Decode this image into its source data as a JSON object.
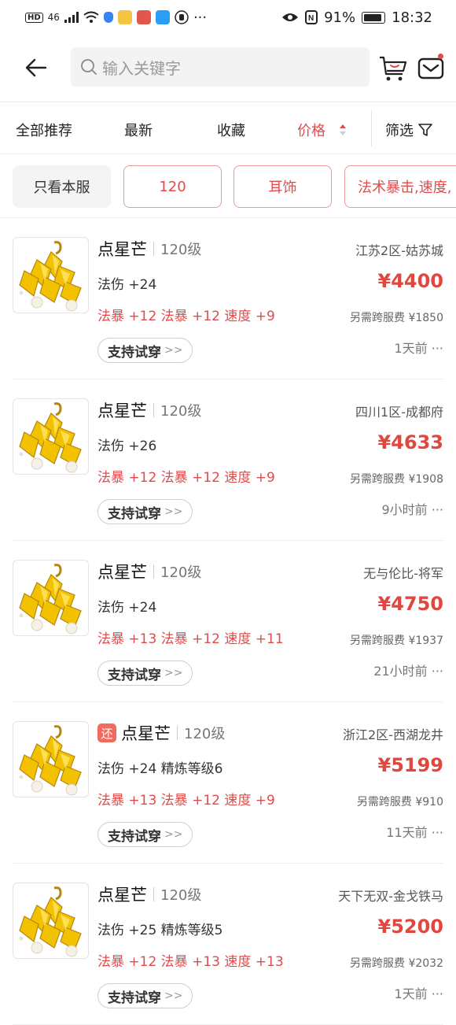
{
  "status_bar": {
    "left_badge": "HD",
    "signal": "46",
    "more": "···",
    "battery": "91%",
    "time": "18:32"
  },
  "header": {
    "search_placeholder": "输入关键字"
  },
  "tabs": {
    "items": [
      "全部推荐",
      "最新",
      "收藏",
      "价格"
    ],
    "active": "价格",
    "filter_label": "筛选"
  },
  "chips": [
    "只看本服",
    "120",
    "耳饰",
    "法术暴击,速度,"
  ],
  "listings": [
    {
      "name": "点星芒",
      "has_badge": false,
      "level": "120级",
      "attr1": "法伤 +24",
      "attr2": "法暴 +12 法暴 +12 速度 +9",
      "server": "江苏2区-姑苏城",
      "price": "¥4400",
      "fee": "另需跨服费 ¥1850",
      "time": "1天前 ···",
      "tryon": "支持试穿"
    },
    {
      "name": "点星芒",
      "has_badge": false,
      "level": "120级",
      "attr1": "法伤 +26",
      "attr2": "法暴 +12 法暴 +12 速度 +9",
      "server": "四川1区-成都府",
      "price": "¥4633",
      "fee": "另需跨服费 ¥1908",
      "time": "9小时前 ···",
      "tryon": "支持试穿"
    },
    {
      "name": "点星芒",
      "has_badge": false,
      "level": "120级",
      "attr1": "法伤 +24",
      "attr2": "法暴 +13 法暴 +12 速度 +11",
      "server": "无与伦比-将军",
      "price": "¥4750",
      "fee": "另需跨服费 ¥1937",
      "time": "21小时前 ···",
      "tryon": "支持试穿"
    },
    {
      "name": "点星芒",
      "has_badge": true,
      "badge": "还",
      "level": "120级",
      "attr1": "法伤 +24 精炼等级6",
      "attr2": "法暴 +13 法暴 +12 速度 +9",
      "server": "浙江2区-西湖龙井",
      "price": "¥5199",
      "fee": "另需跨服费 ¥910",
      "time": "11天前 ···",
      "tryon": "支持试穿"
    },
    {
      "name": "点星芒",
      "has_badge": false,
      "level": "120级",
      "attr1": "法伤 +25 精炼等级5",
      "attr2": "法暴 +12 法暴 +13 速度 +13",
      "server": "天下无双-金戈铁马",
      "price": "¥5200",
      "fee": "另需跨服费 ¥2032",
      "time": "1天前 ···",
      "tryon": "支持试穿"
    }
  ],
  "colors": {
    "accent": "#e04b4b",
    "price": "#e0473f",
    "badge": "#f06a5e"
  }
}
